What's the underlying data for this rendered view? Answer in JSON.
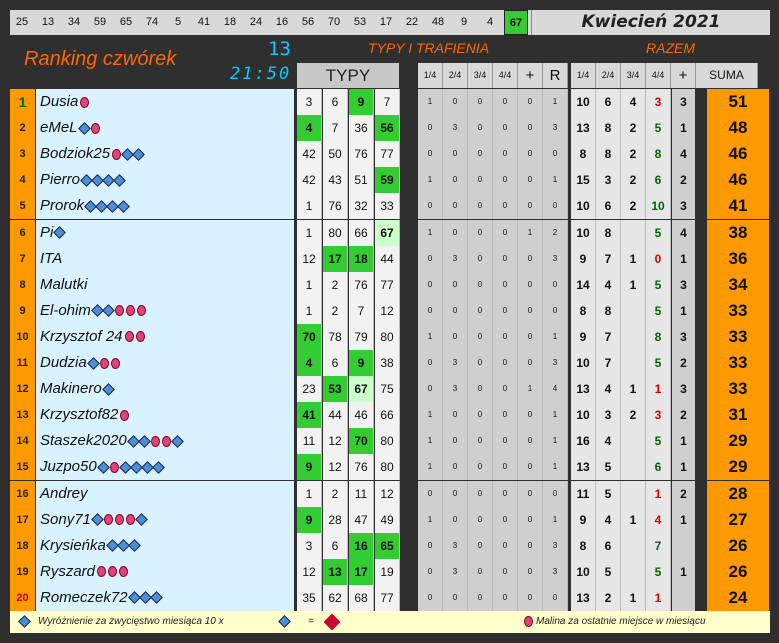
{
  "drawn_numbers": [
    "25",
    "13",
    "34",
    "59",
    "65",
    "74",
    "5",
    "41",
    "18",
    "24",
    "16",
    "56",
    "70",
    "53",
    "17",
    "22",
    "48",
    "9",
    "4",
    "67"
  ],
  "highlighted_number": "67",
  "month": "Kwiecień 2021",
  "title": "Ranking czwórek",
  "draw_count": "13",
  "draw_time": "21:50",
  "header_typy_trafienia": "TYPY I TRAFIENIA",
  "header_razem": "RAZEM",
  "typy_label": "TYPY",
  "columns": [
    "1/4",
    "2/4",
    "3/4",
    "4/4",
    "+",
    "R",
    "1/4",
    "2/4",
    "3/4",
    "4/4",
    "+",
    "SUMA"
  ],
  "rows": [
    {
      "rank": "1",
      "name": "Dusia",
      "icons": [
        "m"
      ],
      "typy": [
        "3",
        "6",
        "9",
        "7"
      ],
      "hits": [
        2
      ],
      "stats": [
        "1",
        "0",
        "0",
        "0",
        "0",
        "1"
      ],
      "totals": [
        "10",
        "6",
        "4",
        "3"
      ],
      "plus": "3",
      "suma": "51"
    },
    {
      "rank": "2",
      "name": "eMeL",
      "icons": [
        "d",
        "m"
      ],
      "typy": [
        "4",
        "7",
        "36",
        "56"
      ],
      "hits": [
        0,
        3
      ],
      "stats": [
        "0",
        "3",
        "0",
        "0",
        "0",
        "3"
      ],
      "totals": [
        "13",
        "8",
        "2",
        "5"
      ],
      "plus": "1",
      "suma": "48"
    },
    {
      "rank": "3",
      "name": "Bodziok25",
      "icons": [
        "m",
        "d",
        "d"
      ],
      "typy": [
        "42",
        "50",
        "76",
        "77"
      ],
      "hits": [],
      "stats": [
        "0",
        "0",
        "0",
        "0",
        "0",
        "0"
      ],
      "totals": [
        "8",
        "8",
        "2",
        "8"
      ],
      "plus": "4",
      "suma": "46"
    },
    {
      "rank": "4",
      "name": "Pierro",
      "icons": [
        "d",
        "d",
        "d",
        "d"
      ],
      "typy": [
        "42",
        "43",
        "51",
        "59"
      ],
      "hits": [
        3
      ],
      "stats": [
        "1",
        "0",
        "0",
        "0",
        "0",
        "1"
      ],
      "totals": [
        "15",
        "3",
        "2",
        "6"
      ],
      "plus": "2",
      "suma": "46"
    },
    {
      "rank": "5",
      "name": "Prorok",
      "icons": [
        "d",
        "d",
        "d",
        "d"
      ],
      "typy": [
        "1",
        "76",
        "32",
        "33"
      ],
      "hits": [],
      "stats": [
        "0",
        "0",
        "0",
        "0",
        "0",
        "0"
      ],
      "totals": [
        "10",
        "6",
        "2",
        "10"
      ],
      "plus": "3",
      "suma": "41"
    },
    {
      "rank": "6",
      "name": "Pi",
      "icons": [
        "d"
      ],
      "typy": [
        "1",
        "80",
        "66",
        "67"
      ],
      "hits": [],
      "pale": [
        3
      ],
      "stats": [
        "1",
        "0",
        "0",
        "0",
        "1",
        "2"
      ],
      "totals": [
        "10",
        "8",
        "",
        "5"
      ],
      "plus": "4",
      "suma": "38"
    },
    {
      "rank": "7",
      "name": "ITA",
      "icons": [],
      "typy": [
        "12",
        "17",
        "18",
        "44"
      ],
      "hits": [
        1,
        2
      ],
      "stats": [
        "0",
        "3",
        "0",
        "0",
        "0",
        "3"
      ],
      "totals": [
        "9",
        "7",
        "1",
        "0"
      ],
      "plus": "1",
      "suma": "36"
    },
    {
      "rank": "8",
      "name": "Malutki",
      "icons": [],
      "typy": [
        "1",
        "2",
        "76",
        "77"
      ],
      "hits": [],
      "stats": [
        "0",
        "0",
        "0",
        "0",
        "0",
        "0"
      ],
      "totals": [
        "14",
        "4",
        "1",
        "5"
      ],
      "plus": "3",
      "suma": "34"
    },
    {
      "rank": "9",
      "name": "El-ohim",
      "icons": [
        "d",
        "d",
        "m",
        "m",
        "m"
      ],
      "typy": [
        "1",
        "2",
        "7",
        "12"
      ],
      "hits": [],
      "stats": [
        "0",
        "0",
        "0",
        "0",
        "0",
        "0"
      ],
      "totals": [
        "8",
        "8",
        "",
        "5"
      ],
      "plus": "1",
      "suma": "33"
    },
    {
      "rank": "10",
      "name": "Krzysztof 24",
      "icons": [
        "m",
        "m"
      ],
      "typy": [
        "70",
        "78",
        "79",
        "80"
      ],
      "hits": [
        0
      ],
      "stats": [
        "1",
        "0",
        "0",
        "0",
        "0",
        "1"
      ],
      "totals": [
        "9",
        "7",
        "",
        "8"
      ],
      "plus": "3",
      "suma": "33"
    },
    {
      "rank": "11",
      "name": "Dudzia",
      "icons": [
        "d",
        "m",
        "m"
      ],
      "typy": [
        "4",
        "6",
        "9",
        "38"
      ],
      "hits": [
        0,
        2
      ],
      "stats": [
        "0",
        "3",
        "0",
        "0",
        "0",
        "3"
      ],
      "totals": [
        "10",
        "7",
        "",
        "5"
      ],
      "plus": "2",
      "suma": "33"
    },
    {
      "rank": "12",
      "name": "Makinero",
      "icons": [
        "d"
      ],
      "typy": [
        "23",
        "53",
        "67",
        "75"
      ],
      "hits": [
        1
      ],
      "pale": [
        2
      ],
      "stats": [
        "0",
        "3",
        "0",
        "0",
        "1",
        "4"
      ],
      "totals": [
        "13",
        "4",
        "1",
        "1"
      ],
      "plus": "3",
      "suma": "33"
    },
    {
      "rank": "13",
      "name": "Krzysztof82",
      "icons": [
        "m"
      ],
      "typy": [
        "41",
        "44",
        "46",
        "66"
      ],
      "hits": [
        0
      ],
      "stats": [
        "1",
        "0",
        "0",
        "0",
        "0",
        "1"
      ],
      "totals": [
        "10",
        "3",
        "2",
        "3"
      ],
      "plus": "2",
      "suma": "31"
    },
    {
      "rank": "14",
      "name": "Staszek2020",
      "icons": [
        "d",
        "d",
        "m",
        "m",
        "d"
      ],
      "typy": [
        "11",
        "12",
        "70",
        "80"
      ],
      "hits": [
        2
      ],
      "stats": [
        "1",
        "0",
        "0",
        "0",
        "0",
        "1"
      ],
      "totals": [
        "16",
        "4",
        "",
        "5"
      ],
      "plus": "1",
      "suma": "29"
    },
    {
      "rank": "15",
      "name": "Juzpo50",
      "icons": [
        "d",
        "m",
        "d",
        "d",
        "d",
        "d"
      ],
      "typy": [
        "9",
        "12",
        "76",
        "80"
      ],
      "hits": [
        0
      ],
      "stats": [
        "1",
        "0",
        "0",
        "0",
        "0",
        "1"
      ],
      "totals": [
        "13",
        "5",
        "",
        "6"
      ],
      "plus": "1",
      "suma": "29"
    },
    {
      "rank": "16",
      "name": "Andrey",
      "icons": [],
      "typy": [
        "1",
        "2",
        "11",
        "12"
      ],
      "hits": [],
      "stats": [
        "0",
        "0",
        "0",
        "0",
        "0",
        "0"
      ],
      "totals": [
        "11",
        "5",
        "",
        "1"
      ],
      "plus": "2",
      "suma": "28"
    },
    {
      "rank": "17",
      "name": "Sony71",
      "icons": [
        "d",
        "m",
        "m",
        "m",
        "d"
      ],
      "typy": [
        "9",
        "28",
        "47",
        "49"
      ],
      "hits": [
        0
      ],
      "stats": [
        "1",
        "0",
        "0",
        "0",
        "0",
        "1"
      ],
      "totals": [
        "9",
        "4",
        "1",
        "4"
      ],
      "plus": "1",
      "suma": "27"
    },
    {
      "rank": "18",
      "name": "Krysieńka",
      "icons": [
        "d",
        "d",
        "d"
      ],
      "typy": [
        "3",
        "6",
        "16",
        "65"
      ],
      "hits": [
        2,
        3
      ],
      "stats": [
        "0",
        "3",
        "0",
        "0",
        "0",
        "3"
      ],
      "totals": [
        "8",
        "6",
        "",
        "7"
      ],
      "plus": "",
      "suma": "26"
    },
    {
      "rank": "19",
      "name": "Ryszard",
      "icons": [
        "m",
        "m",
        "m"
      ],
      "typy": [
        "12",
        "13",
        "17",
        "19"
      ],
      "hits": [
        1,
        2
      ],
      "stats": [
        "0",
        "3",
        "0",
        "0",
        "0",
        "3"
      ],
      "totals": [
        "10",
        "5",
        "",
        "5"
      ],
      "plus": "1",
      "suma": "26"
    },
    {
      "rank": "20",
      "name": "Romeczek72",
      "icons": [
        "d",
        "d",
        "d"
      ],
      "typy": [
        "35",
        "62",
        "68",
        "77"
      ],
      "hits": [],
      "stats": [
        "0",
        "0",
        "0",
        "0",
        "0",
        "0"
      ],
      "totals": [
        "13",
        "2",
        "1",
        "1"
      ],
      "plus": "",
      "suma": "24"
    }
  ],
  "footer_left": "Wyróżnienie za zwycięstwo miesiąca  10 x",
  "footer_eq": "=",
  "footer_right": "Malina za ostatnie miejsce w miesiącu",
  "colors": {
    "hit": "#33cc33",
    "rank": "#ff9900",
    "name_bg": "#d9f2ff",
    "title": "#ff6600",
    "accent": "#00ccff"
  }
}
